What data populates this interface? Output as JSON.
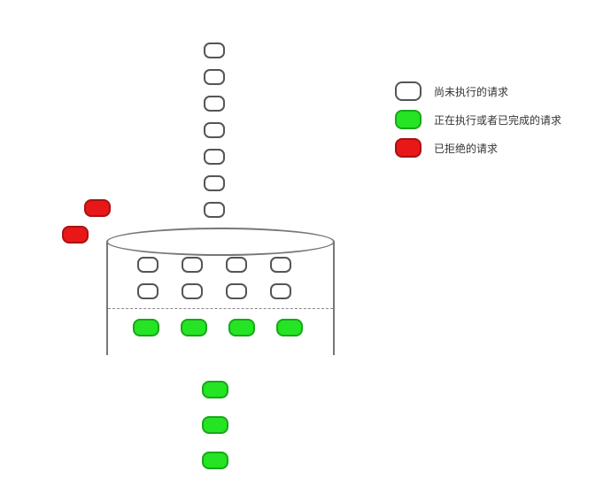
{
  "diagram": {
    "incoming_queue": [
      "white",
      "white",
      "white",
      "white",
      "white",
      "white",
      "white"
    ],
    "rejected": [
      "red",
      "red"
    ],
    "bucket": {
      "rows": [
        [
          "white",
          "white",
          "white",
          "white"
        ],
        [
          "white",
          "white",
          "white",
          "white"
        ],
        [
          "green",
          "green",
          "green",
          "green"
        ]
      ]
    },
    "outgoing_queue": [
      "green",
      "green",
      "green"
    ]
  },
  "legend": {
    "pending": "尚未执行的请求",
    "active": "正在执行或者已完成的请求",
    "rejected": "已拒绝的请求"
  },
  "colors": {
    "white": "#ffffff",
    "green": "#24e424",
    "red": "#e81818"
  }
}
